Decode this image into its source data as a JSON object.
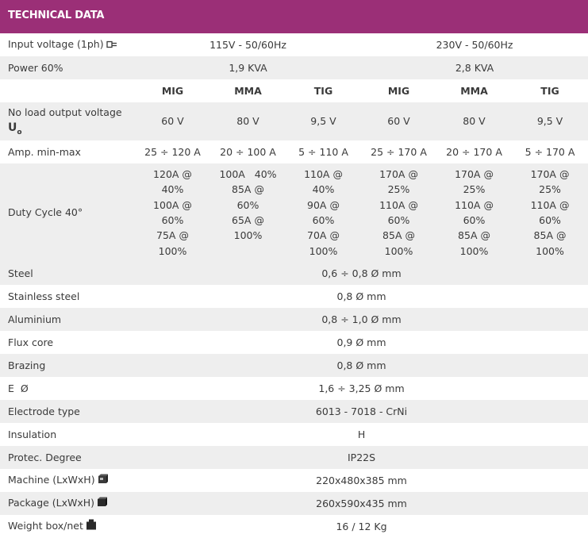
{
  "header": {
    "title": "TECHNICAL DATA"
  },
  "input_voltage": {
    "label": "Input voltage (1ph)",
    "v1": "115V - 50/60Hz",
    "v2": "230V - 50/60Hz"
  },
  "power": {
    "label": "Power 60%",
    "v1": "1,9 KVA",
    "v2": "2,8 KVA"
  },
  "processes": [
    "MIG",
    "MMA",
    "TIG",
    "MIG",
    "MMA",
    "TIG"
  ],
  "no_load": {
    "label": "No load output voltage",
    "symbol": "U",
    "symbol_sub": "o",
    "values": [
      "60  V",
      "80  V",
      "9,5  V",
      "60  V",
      "80  V",
      "9,5  V"
    ]
  },
  "amp": {
    "label": "Amp. min-max",
    "values": [
      "25 ÷ 120  A",
      "20 ÷ 100  A",
      "5 ÷ 110  A",
      "25 ÷ 170  A",
      "20 ÷ 170  A",
      "5 ÷ 170  A"
    ]
  },
  "duty": {
    "label": "Duty Cycle 40°",
    "columns": [
      [
        "120A @",
        "40%",
        "100A @",
        "60%",
        "75A @",
        "100%"
      ],
      [
        "100A   40%",
        "85A @",
        "60%",
        "65A @",
        "100%"
      ],
      [
        "110A @",
        "40%",
        "90A @",
        "60%",
        "70A @",
        "100%"
      ],
      [
        "170A @",
        "25%",
        "110A @",
        "60%",
        "85A @",
        "100%"
      ],
      [
        "170A @",
        "25%",
        "110A @",
        "60%",
        "85A @",
        "100%"
      ],
      [
        "170A @",
        "25%",
        "110A @",
        "60%",
        "85A @",
        "100%"
      ]
    ]
  },
  "rows": [
    {
      "label": "Steel",
      "value": "0,6 ÷ 0,8 Ø mm"
    },
    {
      "label": "Stainless steel",
      "value": "0,8 Ø mm"
    },
    {
      "label": "Aluminium",
      "value": "0,8 ÷ 1,0 Ø mm"
    },
    {
      "label": "Flux core",
      "value": "0,9 Ø mm"
    },
    {
      "label": "Brazing",
      "value": "0,8 Ø mm"
    },
    {
      "label": "E  Ø",
      "value": "1,6 ÷ 3,25 Ø mm"
    },
    {
      "label": "Electrode type",
      "value": "6013 - 7018 - CrNi"
    },
    {
      "label": "Insulation",
      "value": "H"
    },
    {
      "label": "Protec. Degree",
      "value": "IP22S"
    },
    {
      "label": "Machine (LxWxH)",
      "value": "220x480x385 mm",
      "icon": "machine-box-icon"
    },
    {
      "label": "Package (LxWxH)",
      "value": "260x590x435 mm",
      "icon": "package-box-icon"
    },
    {
      "label": "Weight box/net",
      "value": "16 / 12 Kg",
      "icon": "weight-icon"
    }
  ],
  "colors": {
    "header_bg": "#9b2f77",
    "row_alt": "#eeeeee",
    "text": "#3a3a3a"
  }
}
